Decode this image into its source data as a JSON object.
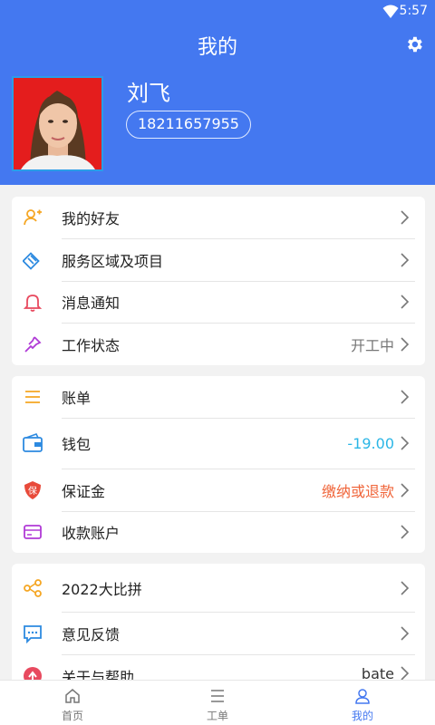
{
  "status": {
    "time": "5:57"
  },
  "header": {
    "title": "我的"
  },
  "profile": {
    "name": "刘飞",
    "phone": "18211657955"
  },
  "colors": {
    "primary": "#4478f0",
    "wallet_value": "#2bb6e6",
    "deposit_value": "#f0653a"
  },
  "card1": [
    {
      "label": "我的好友",
      "icon": "friend-add-icon",
      "value": ""
    },
    {
      "label": "服务区域及项目",
      "icon": "service-area-icon",
      "value": ""
    },
    {
      "label": "消息通知",
      "icon": "bell-icon",
      "value": ""
    },
    {
      "label": "工作状态",
      "icon": "pin-icon",
      "value": "开工中"
    }
  ],
  "card2": [
    {
      "label": "账单",
      "icon": "list-icon",
      "value": ""
    },
    {
      "label": "钱包",
      "icon": "wallet-icon",
      "value": "-19.00"
    },
    {
      "label": "保证金",
      "icon": "deposit-shield-icon",
      "value": "缴纳或退款",
      "badge": "保"
    },
    {
      "label": "收款账户",
      "icon": "card-icon",
      "value": ""
    }
  ],
  "card3": [
    {
      "label": "2022大比拼",
      "icon": "share-icon",
      "value": ""
    },
    {
      "label": "意见反馈",
      "icon": "feedback-icon",
      "value": ""
    },
    {
      "label": "关于与帮助",
      "icon": "help-icon",
      "value": "bate"
    }
  ],
  "tabbar": [
    {
      "label": "首页",
      "icon": "home-icon",
      "active": false
    },
    {
      "label": "工单",
      "icon": "menu-icon",
      "active": false
    },
    {
      "label": "我的",
      "icon": "person-icon",
      "active": true
    }
  ]
}
